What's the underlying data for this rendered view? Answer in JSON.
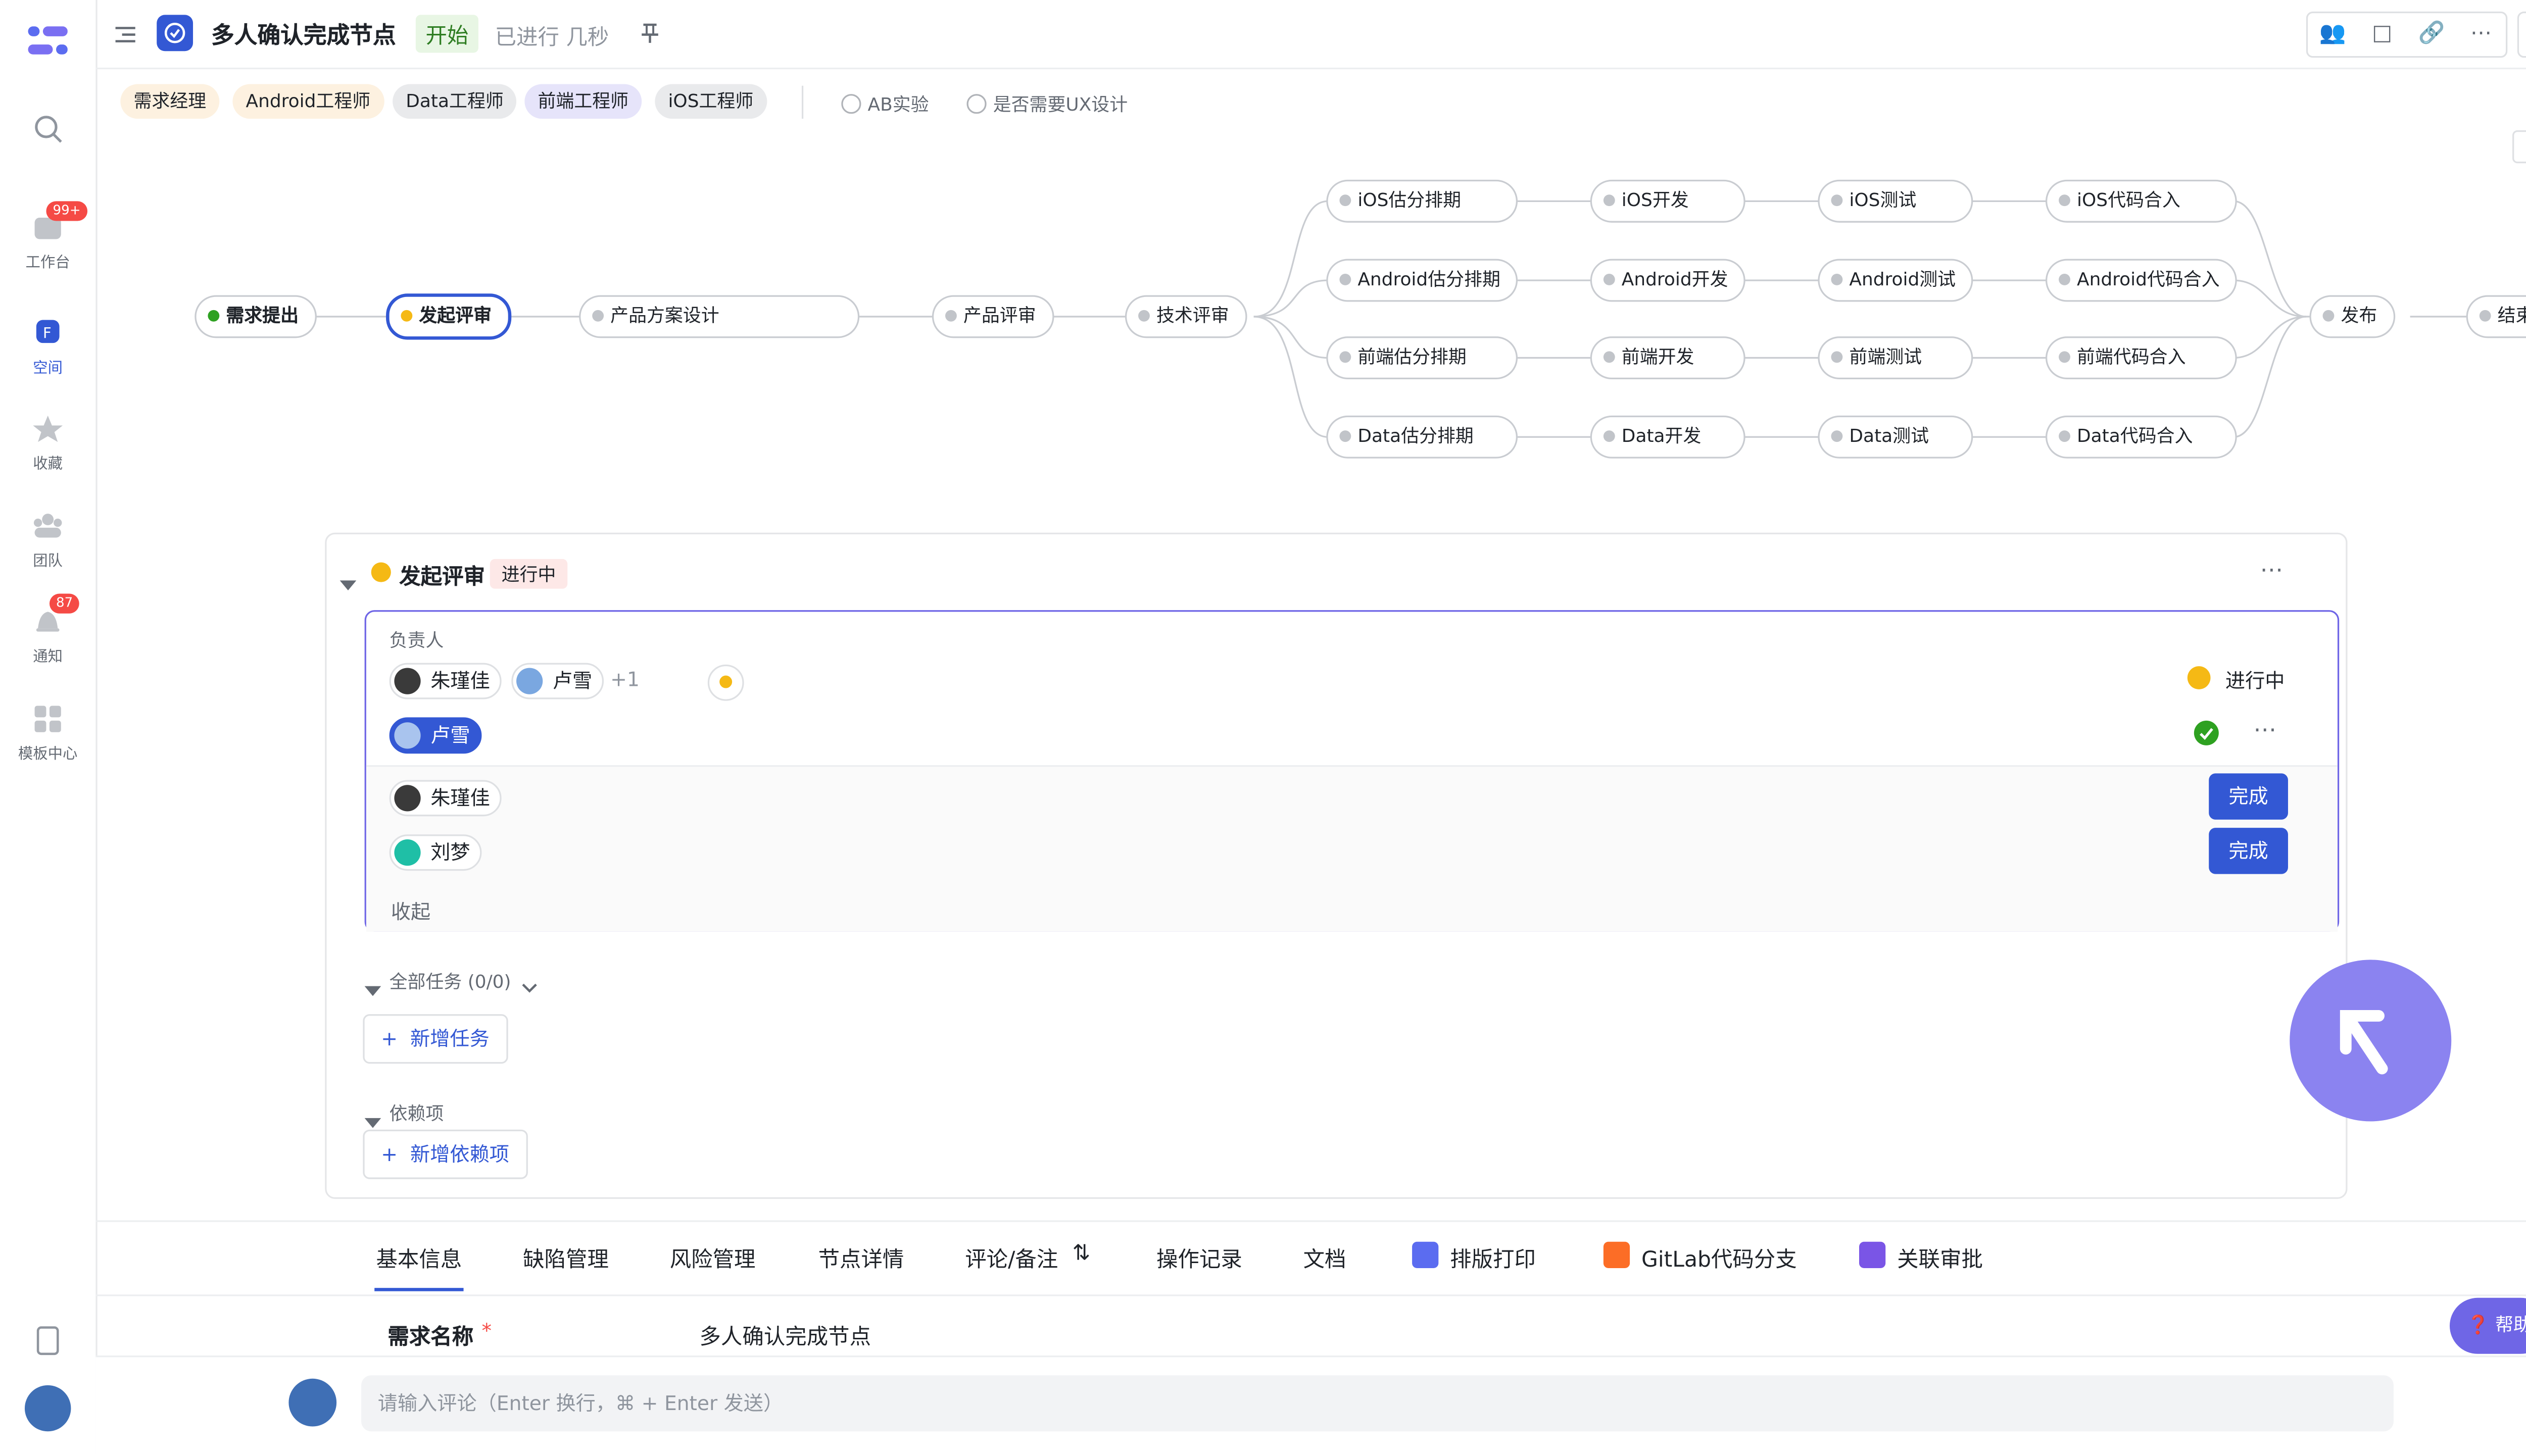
{
  "header": {
    "title": "多人确认完成节点",
    "status_tag": "开始",
    "elapsed": "已进行 几秒"
  },
  "roles": [
    "需求经理",
    "Android工程师",
    "Data工程师",
    "前端工程师",
    "iOS工程师"
  ],
  "options": [
    "AB实验",
    "是否需要UX设计"
  ],
  "sidebar": {
    "items": [
      {
        "label": "",
        "icon": "search-icon"
      },
      {
        "label": "工作台",
        "icon": "workbench-icon",
        "badge": "99+"
      },
      {
        "label": "空间",
        "icon": "space-icon"
      },
      {
        "label": "收藏",
        "icon": "star-icon"
      },
      {
        "label": "团队",
        "icon": "team-icon"
      },
      {
        "label": "通知",
        "icon": "bell-icon",
        "badge": "87"
      },
      {
        "label": "模板中心",
        "icon": "template-icon"
      }
    ]
  },
  "flow": {
    "main": [
      "需求提出",
      "发起评审",
      "产品方案设计",
      "产品评审",
      "技术评审",
      "发布",
      "结束"
    ],
    "rows": [
      [
        "iOS估分排期",
        "iOS开发",
        "iOS测试",
        "iOS代码合入"
      ],
      [
        "Android估分排期",
        "Android开发",
        "Android测试",
        "Android代码合入"
      ],
      [
        "前端估分排期",
        "前端开发",
        "前端测试",
        "前端代码合入"
      ],
      [
        "Data估分排期",
        "Data开发",
        "Data测试",
        "Data代码合入"
      ]
    ]
  },
  "panel": {
    "title": "发起评审",
    "status": "进行中",
    "owner_label": "负责人",
    "owners": [
      "朱瑾佳",
      "卢雪"
    ],
    "more_count": "+1",
    "owner_status": "进行中",
    "confirmed": "卢雪",
    "pending": [
      {
        "name": "朱瑾佳",
        "action": "完成"
      },
      {
        "name": "刘梦",
        "action": "完成"
      }
    ],
    "collapse": "收起",
    "all_tasks": "全部任务 (0/0)",
    "add_task": "新增任务",
    "deps_label": "依赖项",
    "add_dep": "新增依赖项"
  },
  "tabs": [
    "基本信息",
    "缺陷管理",
    "风险管理",
    "节点详情",
    "评论/备注",
    "操作记录",
    "文档",
    "排版打印",
    "GitLab代码分支",
    "关联审批"
  ],
  "basic": {
    "field_label": "需求名称",
    "field_value": "多人确认完成节点"
  },
  "comment_placeholder": "请输入评论（Enter 换行，⌘ + Enter 发送）",
  "help": "帮助",
  "colors": {
    "accent": "#3358d4",
    "purple": "#6f66e6",
    "done": "#2ea121",
    "active": "#f5b915"
  }
}
